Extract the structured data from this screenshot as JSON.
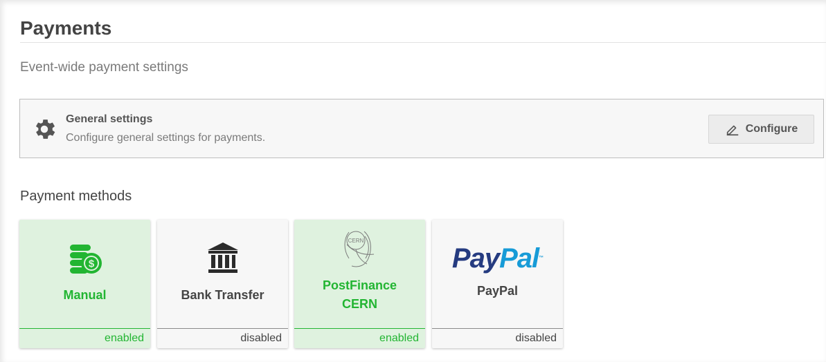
{
  "page": {
    "title": "Payments",
    "subtitle": "Event-wide payment settings"
  },
  "general_settings": {
    "icon": "gear-icon",
    "title": "General settings",
    "description": "Configure general settings for payments.",
    "configure_label": "Configure",
    "configure_icon": "edit-icon"
  },
  "methods": {
    "heading": "Payment methods",
    "items": [
      {
        "label": "Manual",
        "status": "enabled",
        "icon": "coins-icon"
      },
      {
        "label": "Bank Transfer",
        "status": "disabled",
        "icon": "bank-icon"
      },
      {
        "label_line1": "PostFinance",
        "label_line2": "CERN",
        "status": "enabled",
        "icon": "cern-logo"
      },
      {
        "logo_pay": "Pay",
        "logo_pal": "Pal",
        "logo_tm": "™",
        "label": "PayPal",
        "status": "disabled",
        "icon": "paypal-logo"
      }
    ]
  },
  "colors": {
    "enabled_bg": "#dff2df",
    "enabled_text": "#22b532",
    "disabled_bg": "#f7f7f7",
    "paypal_dark": "#253b80",
    "paypal_light": "#179bd7"
  }
}
